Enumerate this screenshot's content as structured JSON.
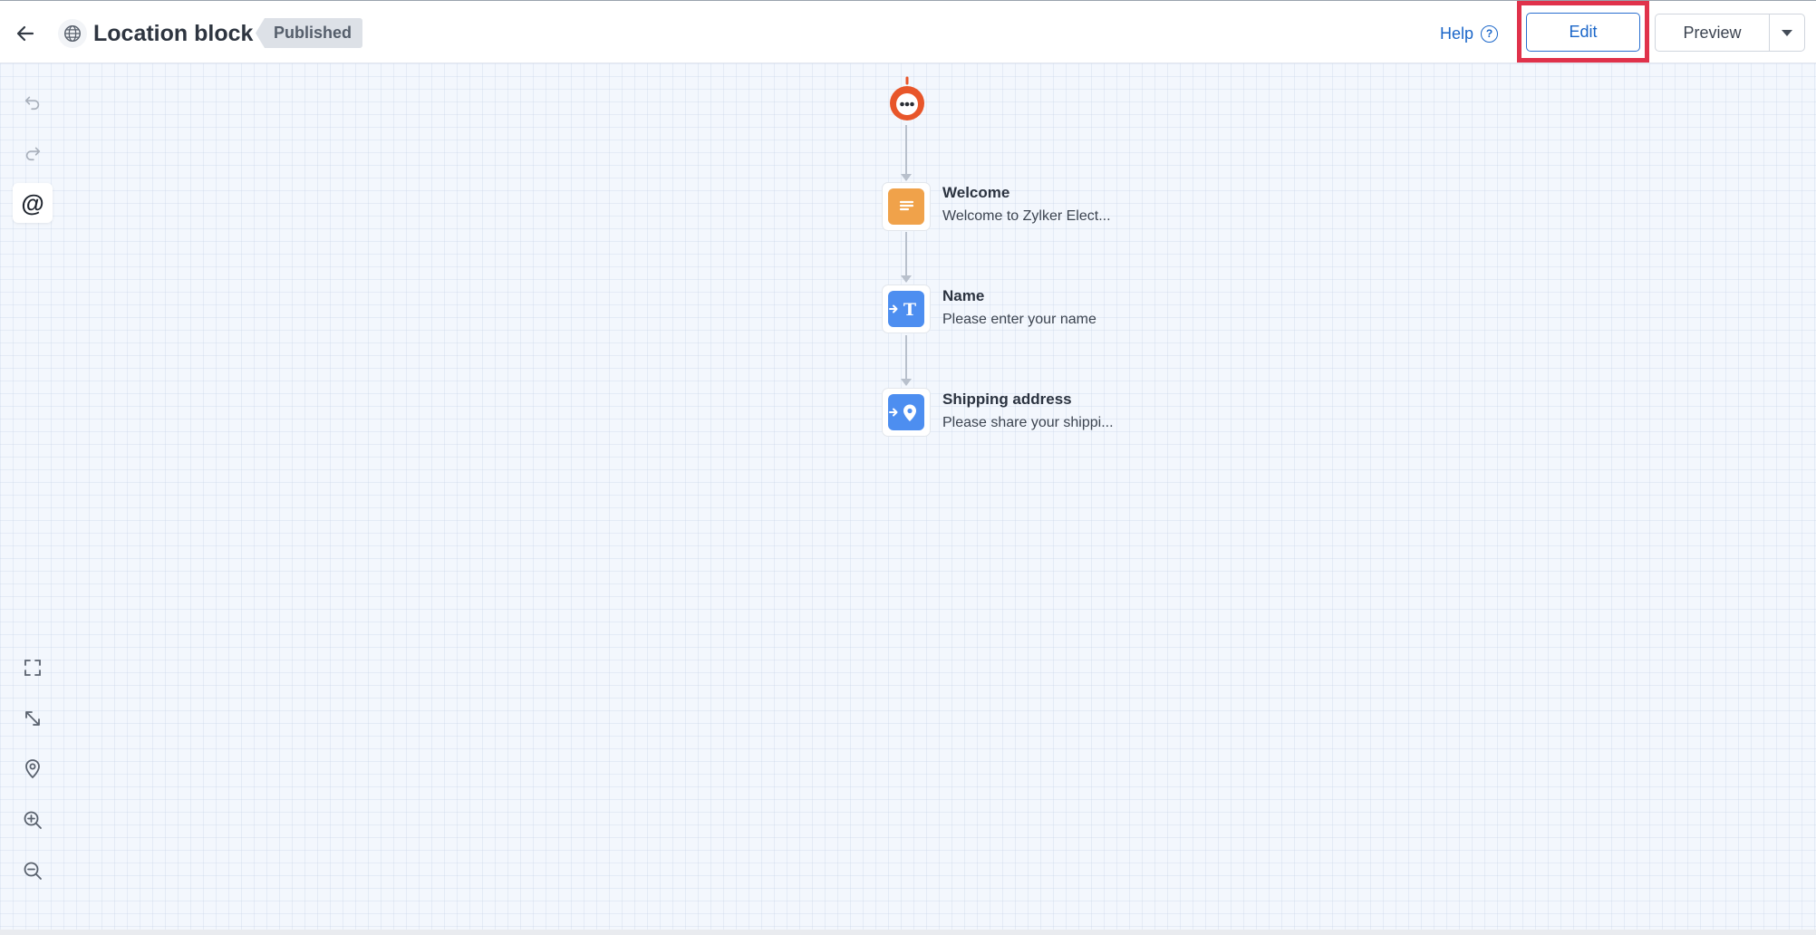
{
  "header": {
    "back_icon": "arrow-left-icon",
    "globe_icon": "globe-icon",
    "title": "Location block",
    "status": "Published",
    "help_label": "Help",
    "help_icon": "question-circle-icon",
    "edit_label": "Edit",
    "preview_label": "Preview",
    "preview_dropdown_icon": "caret-down-icon"
  },
  "toolbar_top": [
    {
      "name": "undo",
      "icon": "undo-icon"
    },
    {
      "name": "redo",
      "icon": "redo-icon"
    },
    {
      "name": "mention",
      "icon": "at-sign-icon",
      "label": "@"
    }
  ],
  "toolbar_bottom": [
    {
      "name": "fit-screen",
      "icon": "fit-screen-icon"
    },
    {
      "name": "expand",
      "icon": "expand-arrows-icon"
    },
    {
      "name": "locate",
      "icon": "location-pin-icon"
    },
    {
      "name": "zoom-in",
      "icon": "zoom-in-icon"
    },
    {
      "name": "zoom-out",
      "icon": "zoom-out-icon"
    }
  ],
  "flow": {
    "start_icon": "bot-icon",
    "nodes": [
      {
        "title": "Welcome",
        "subtitle": "Welcome to Zylker Elect...",
        "icon": "message-icon",
        "color": "#f0a24a"
      },
      {
        "title": "Name",
        "subtitle": "Please enter your name",
        "icon": "text-input-icon",
        "color": "#4d8ef0"
      },
      {
        "title": "Shipping address",
        "subtitle": "Please share your shippi...",
        "icon": "location-input-icon",
        "color": "#4d8ef0"
      }
    ]
  },
  "colors": {
    "accent": "#1a66c9",
    "highlight": "#e0324b",
    "bot": "#e8562a"
  }
}
